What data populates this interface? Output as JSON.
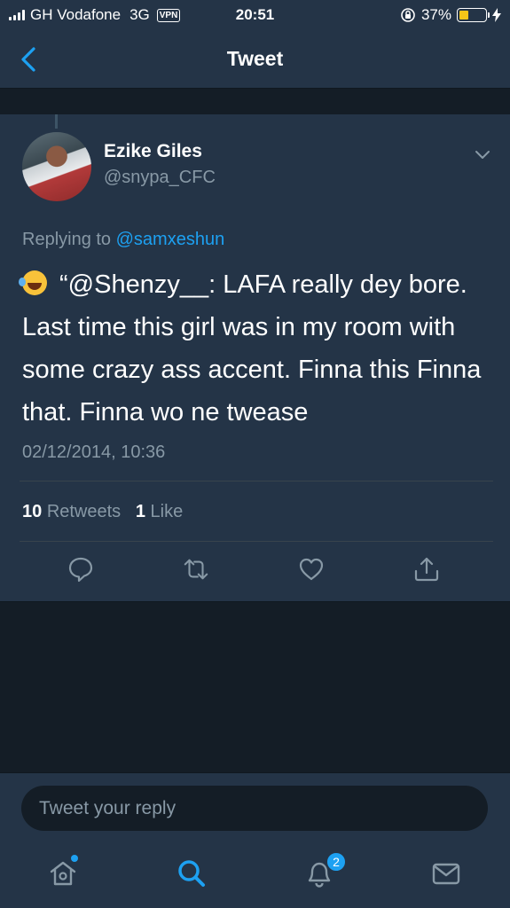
{
  "status_bar": {
    "carrier": "GH Vodafone",
    "network": "3G",
    "vpn": "VPN",
    "time": "20:51",
    "battery": "37%",
    "battery_level": 0.37,
    "battery_color": "#f5c518"
  },
  "nav": {
    "back_icon": "chevron-left-icon",
    "title": "Tweet"
  },
  "tweet": {
    "author_name": "Ezike Giles",
    "author_handle": "@snypa_CFC",
    "replying_prefix": "Replying to ",
    "replying_to": "@samxeshun",
    "emoji": "face-with-tears-of-joy",
    "text": "“@Shenzy__: LAFA really dey bore. Last time this girl was in my room with some crazy ass accent. Finna this Finna that. Finna wo ne twease",
    "timestamp": "02/12/2014, 10:36",
    "retweets_count": "10",
    "retweets_label": "Retweets",
    "likes_count": "1",
    "likes_label": "Like"
  },
  "actions": [
    "reply-icon",
    "retweet-icon",
    "like-icon",
    "share-icon"
  ],
  "reply": {
    "placeholder": "Tweet your reply"
  },
  "tab_bar": {
    "tabs": [
      "home-icon",
      "search-icon",
      "notifications-icon",
      "messages-icon"
    ],
    "notification_badge": "2"
  },
  "colors": {
    "accent": "#1da1f2",
    "background": "#141d26",
    "card": "#243447",
    "muted_text": "#8899a6"
  }
}
